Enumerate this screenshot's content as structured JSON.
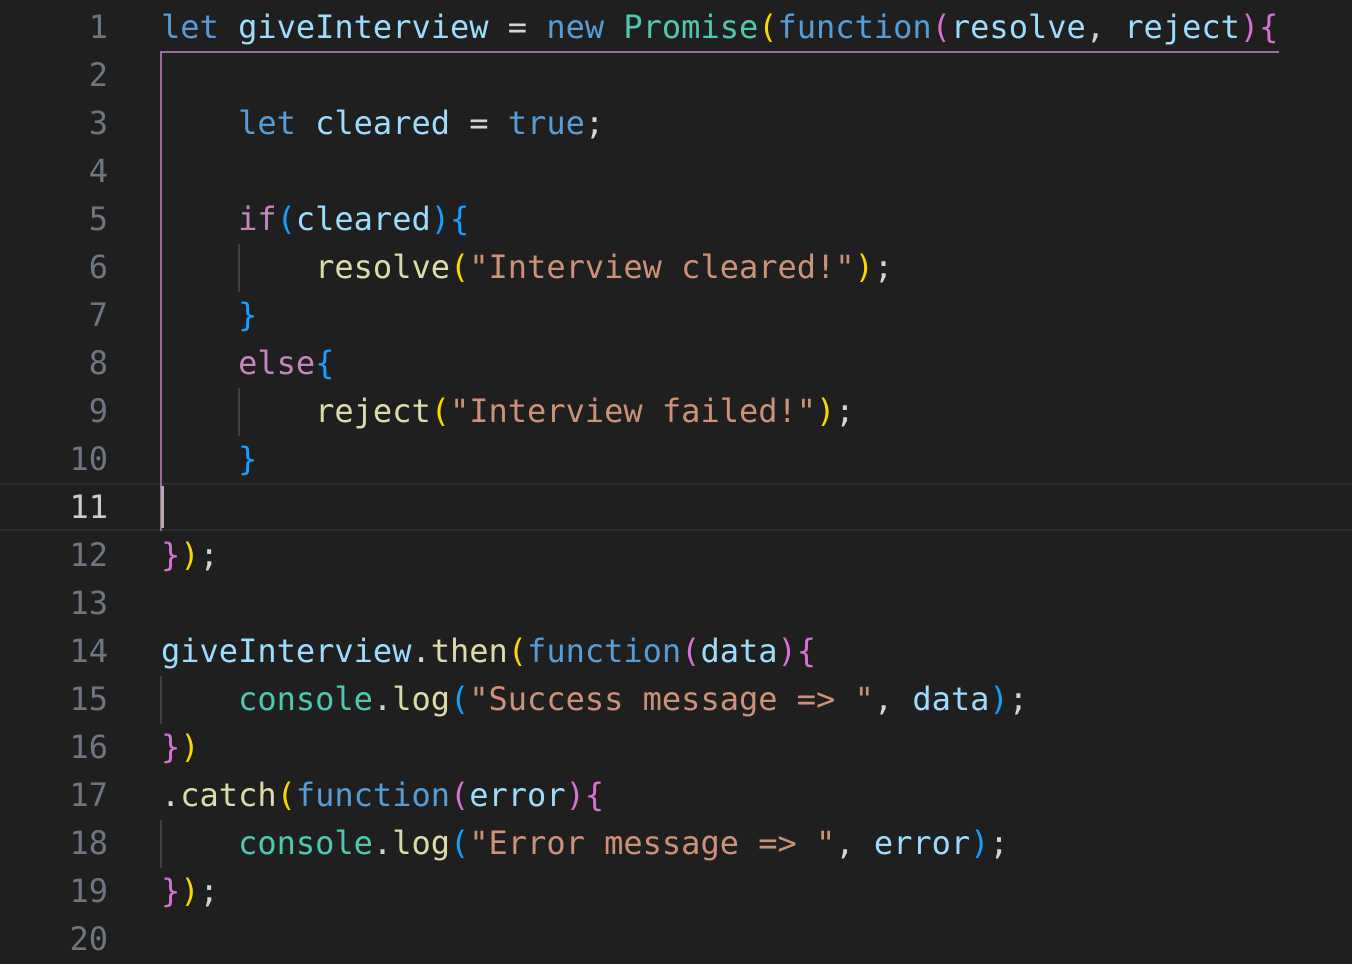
{
  "editor": {
    "active_line": 11,
    "lines": [
      {
        "n": "1",
        "tokens": [
          [
            "kw",
            "let"
          ],
          [
            "op",
            " "
          ],
          [
            "var",
            "giveInterview"
          ],
          [
            "op",
            " = "
          ],
          [
            "kw",
            "new"
          ],
          [
            "op",
            " "
          ],
          [
            "cls",
            "Promise"
          ],
          [
            "b1",
            "("
          ],
          [
            "kw",
            "function"
          ],
          [
            "b2",
            "("
          ],
          [
            "var",
            "resolve"
          ],
          [
            "op",
            ", "
          ],
          [
            "var",
            "reject"
          ],
          [
            "b2",
            ")"
          ],
          [
            "b2",
            "{"
          ]
        ]
      },
      {
        "n": "2",
        "tokens": []
      },
      {
        "n": "3",
        "tokens": [
          [
            "op",
            "    "
          ],
          [
            "kw",
            "let"
          ],
          [
            "op",
            " "
          ],
          [
            "var",
            "cleared"
          ],
          [
            "op",
            " = "
          ],
          [
            "kw",
            "true"
          ],
          [
            "op",
            ";"
          ]
        ]
      },
      {
        "n": "4",
        "tokens": []
      },
      {
        "n": "5",
        "tokens": [
          [
            "op",
            "    "
          ],
          [
            "ctl",
            "if"
          ],
          [
            "b3",
            "("
          ],
          [
            "var",
            "cleared"
          ],
          [
            "b3",
            ")"
          ],
          [
            "b3",
            "{"
          ]
        ]
      },
      {
        "n": "6",
        "tokens": [
          [
            "op",
            "        "
          ],
          [
            "fn",
            "resolve"
          ],
          [
            "b1",
            "("
          ],
          [
            "str",
            "\"Interview cleared!\""
          ],
          [
            "b1",
            ")"
          ],
          [
            "op",
            ";"
          ]
        ]
      },
      {
        "n": "7",
        "tokens": [
          [
            "op",
            "    "
          ],
          [
            "b3",
            "}"
          ]
        ]
      },
      {
        "n": "8",
        "tokens": [
          [
            "op",
            "    "
          ],
          [
            "ctl",
            "else"
          ],
          [
            "b3",
            "{"
          ]
        ]
      },
      {
        "n": "9",
        "tokens": [
          [
            "op",
            "        "
          ],
          [
            "fn",
            "reject"
          ],
          [
            "b1",
            "("
          ],
          [
            "str",
            "\"Interview failed!\""
          ],
          [
            "b1",
            ")"
          ],
          [
            "op",
            ";"
          ]
        ]
      },
      {
        "n": "10",
        "tokens": [
          [
            "op",
            "    "
          ],
          [
            "b3",
            "}"
          ]
        ]
      },
      {
        "n": "11",
        "tokens": []
      },
      {
        "n": "12",
        "tokens": [
          [
            "b2",
            "}"
          ],
          [
            "b1",
            ")"
          ],
          [
            "op",
            ";"
          ]
        ]
      },
      {
        "n": "13",
        "tokens": []
      },
      {
        "n": "14",
        "tokens": [
          [
            "var",
            "giveInterview"
          ],
          [
            "op",
            "."
          ],
          [
            "fn",
            "then"
          ],
          [
            "b1",
            "("
          ],
          [
            "kw",
            "function"
          ],
          [
            "b2",
            "("
          ],
          [
            "var",
            "data"
          ],
          [
            "b2",
            ")"
          ],
          [
            "b2",
            "{"
          ]
        ]
      },
      {
        "n": "15",
        "tokens": [
          [
            "op",
            "    "
          ],
          [
            "cls",
            "console"
          ],
          [
            "op",
            "."
          ],
          [
            "fn",
            "log"
          ],
          [
            "b3",
            "("
          ],
          [
            "str",
            "\"Success message => \""
          ],
          [
            "op",
            ", "
          ],
          [
            "var",
            "data"
          ],
          [
            "b3",
            ")"
          ],
          [
            "op",
            ";"
          ]
        ]
      },
      {
        "n": "16",
        "tokens": [
          [
            "b2",
            "}"
          ],
          [
            "b1",
            ")"
          ]
        ]
      },
      {
        "n": "17",
        "tokens": [
          [
            "op",
            "."
          ],
          [
            "fn",
            "catch"
          ],
          [
            "b1",
            "("
          ],
          [
            "kw",
            "function"
          ],
          [
            "b2",
            "("
          ],
          [
            "var",
            "error"
          ],
          [
            "b2",
            ")"
          ],
          [
            "b2",
            "{"
          ]
        ]
      },
      {
        "n": "18",
        "tokens": [
          [
            "op",
            "    "
          ],
          [
            "cls",
            "console"
          ],
          [
            "op",
            "."
          ],
          [
            "fn",
            "log"
          ],
          [
            "b3",
            "("
          ],
          [
            "str",
            "\"Error message => \""
          ],
          [
            "op",
            ", "
          ],
          [
            "var",
            "error"
          ],
          [
            "b3",
            ")"
          ],
          [
            "op",
            ";"
          ]
        ]
      },
      {
        "n": "19",
        "tokens": [
          [
            "b2",
            "}"
          ],
          [
            "b1",
            ")"
          ],
          [
            "op",
            ";"
          ]
        ]
      },
      {
        "n": "20",
        "tokens": []
      }
    ]
  }
}
